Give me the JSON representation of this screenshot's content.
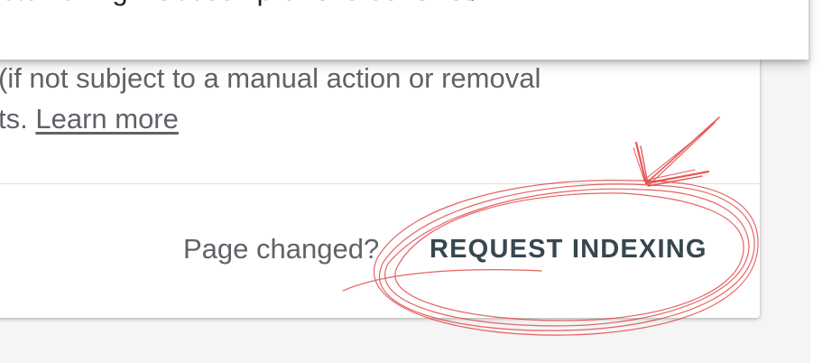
{
  "popup": {
    "url_text": "stonishing macbook pro reverse ferret/"
  },
  "description": {
    "line1": "(if not subject to a manual action or removal",
    "line2_prefix": "ts. ",
    "learn_more": "Learn more"
  },
  "footer": {
    "page_changed_label": "Page changed?",
    "request_indexing_label": "REQUEST INDEXING"
  },
  "colors": {
    "annotation_ink": "#e23b3b",
    "button_text": "#37474f",
    "body_text": "#5f6368"
  },
  "annotation": {
    "shapes": [
      "hand-drawn-arrow",
      "hand-drawn-circle"
    ],
    "target": "request-indexing-button"
  }
}
